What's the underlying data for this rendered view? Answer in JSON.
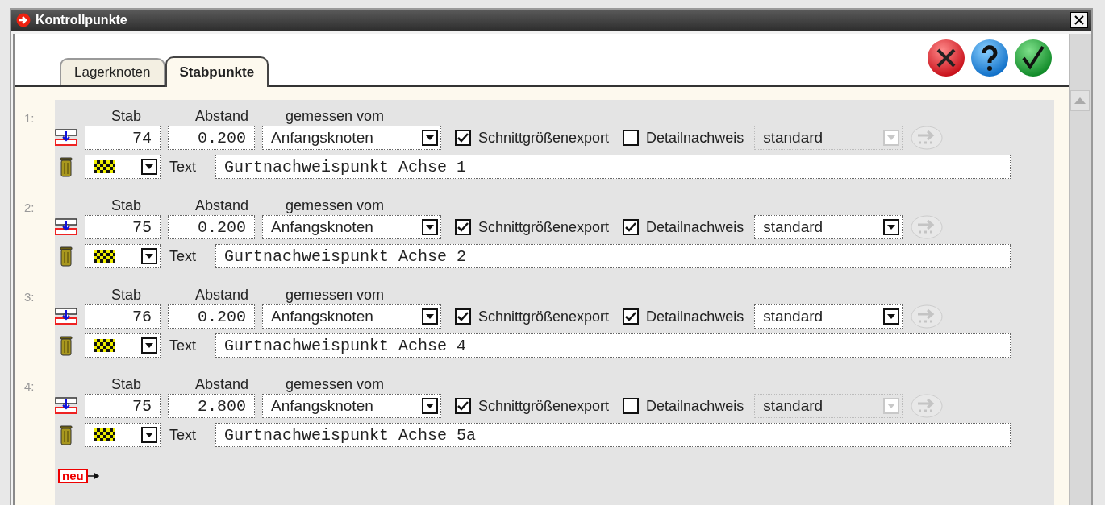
{
  "window": {
    "title": "Kontrollpunkte"
  },
  "tabs": [
    {
      "label": "Lagerknoten",
      "selected": false
    },
    {
      "label": "Stabpunkte",
      "selected": true
    }
  ],
  "rows": [
    {
      "number": "1:",
      "stab_label": "Stab",
      "stab": "74",
      "abstand_label": "Abstand",
      "abstand": "0.200",
      "measured_label": "gemessen vom",
      "measured_from": "Anfangsknoten",
      "export": {
        "label": "Schnittgrößenexport",
        "checked": true
      },
      "detail": {
        "label": "Detailnachweis",
        "checked": false
      },
      "method": {
        "value": "standard",
        "disabled": true
      },
      "text_label": "Text",
      "text": "Gurtnachweispunkt Achse 1"
    },
    {
      "number": "2:",
      "stab_label": "Stab",
      "stab": "75",
      "abstand_label": "Abstand",
      "abstand": "0.200",
      "measured_label": "gemessen vom",
      "measured_from": "Anfangsknoten",
      "export": {
        "label": "Schnittgrößenexport",
        "checked": true
      },
      "detail": {
        "label": "Detailnachweis",
        "checked": true
      },
      "method": {
        "value": "standard",
        "disabled": false
      },
      "text_label": "Text",
      "text": "Gurtnachweispunkt Achse 2"
    },
    {
      "number": "3:",
      "stab_label": "Stab",
      "stab": "76",
      "abstand_label": "Abstand",
      "abstand": "0.200",
      "measured_label": "gemessen vom",
      "measured_from": "Anfangsknoten",
      "export": {
        "label": "Schnittgrößenexport",
        "checked": true
      },
      "detail": {
        "label": "Detailnachweis",
        "checked": true
      },
      "method": {
        "value": "standard",
        "disabled": false
      },
      "text_label": "Text",
      "text": "Gurtnachweispunkt Achse 4"
    },
    {
      "number": "4:",
      "stab_label": "Stab",
      "stab": "75",
      "abstand_label": "Abstand",
      "abstand": "2.800",
      "measured_label": "gemessen vom",
      "measured_from": "Anfangsknoten",
      "export": {
        "label": "Schnittgrößenexport",
        "checked": true
      },
      "detail": {
        "label": "Detailnachweis",
        "checked": false
      },
      "method": {
        "value": "standard",
        "disabled": true
      },
      "text_label": "Text",
      "text": "Gurtnachweispunkt Achse 5a"
    }
  ],
  "new_button": {
    "label": "neu"
  }
}
